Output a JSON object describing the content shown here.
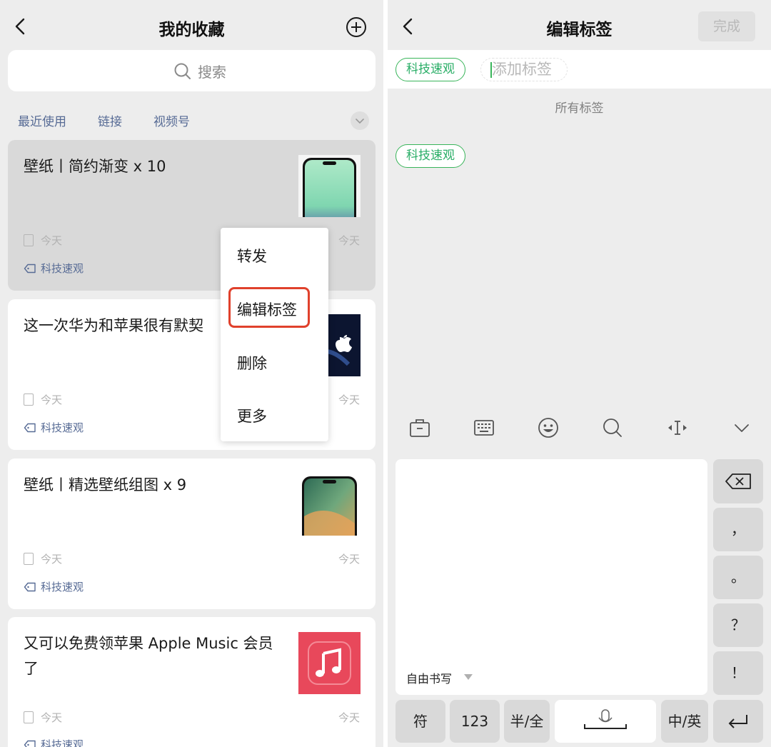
{
  "left": {
    "title": "我的收藏",
    "search_placeholder": "搜索",
    "filters": [
      "最近使用",
      "链接",
      "视频号"
    ],
    "cards": [
      {
        "title": "壁纸丨简约渐变 x 10",
        "date": "今天",
        "date_right": "今天",
        "tag": "科技速观"
      },
      {
        "title": "这一次华为和苹果很有默契",
        "date": "今天",
        "date_right": "今天",
        "tag": "科技速观"
      },
      {
        "title": "壁纸丨精选壁纸组图 x 9",
        "date": "今天",
        "date_right": "今天",
        "tag": "科技速观"
      },
      {
        "title": "又可以免费领苹果 Apple Music 会员了",
        "date": "今天",
        "date_right": "今天",
        "tag": "科技速观"
      }
    ],
    "context_menu": [
      "转发",
      "编辑标签",
      "删除",
      "更多"
    ]
  },
  "right": {
    "title": "编辑标签",
    "done_label": "完成",
    "selected_tags": [
      "科技速观"
    ],
    "add_tag_placeholder": "添加标签",
    "all_tags_label": "所有标签",
    "all_tags": [
      "科技速观"
    ],
    "keyboard": {
      "handwriting_mode": "自由书写",
      "keys_side": [
        "，",
        "。",
        "？",
        "！"
      ],
      "key_fu": "符",
      "key_123": "123",
      "key_half_full": "半/全",
      "key_zh_en": "中/英"
    }
  },
  "colors": {
    "accent_green": "#39b55a",
    "link_blue": "#576b95",
    "highlight_red": "#e0412c"
  }
}
